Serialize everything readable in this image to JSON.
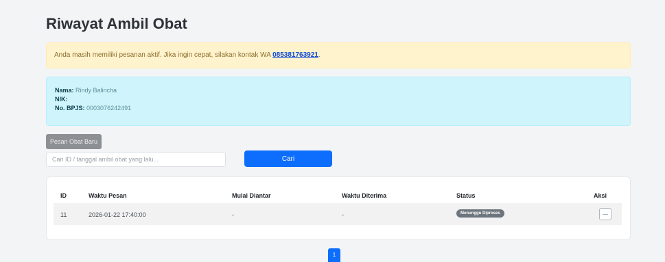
{
  "page": {
    "title": "Riwayat Ambil Obat"
  },
  "notice": {
    "text": "Anda masih memiliki pesanan aktif. Jika ingin cepat, silakan kontak WA ",
    "wa_number": "085381763921",
    "suffix": "."
  },
  "patient": {
    "name_label": "Nama:",
    "name_value": "Rindy Balincha",
    "nik_label": "NIK:",
    "nik_value": "",
    "bpjs_label": "No. BPJS:",
    "bpjs_value": "0003076242491"
  },
  "actions": {
    "new_order_label": "Pesan Obat Baru",
    "search_placeholder": "Cari ID / tanggal ambil obat yang lalu...",
    "search_value": "",
    "search_button_label": "Cari"
  },
  "table": {
    "headers": [
      "ID",
      "Waktu Pesan",
      "Mulai Diantar",
      "Waktu Diterima",
      "Status",
      "Aksi"
    ],
    "rows": [
      {
        "id": "11",
        "waktu_pesan": "2026-01-22 17:40:00",
        "mulai_diantar": "-",
        "waktu_diterima": "-",
        "status": "Menunggu Diproses"
      }
    ]
  },
  "pagination": {
    "current": "1"
  },
  "colors": {
    "primary": "#0d6efd",
    "warning_bg": "#fff3cd",
    "info_bg": "#cff4fc",
    "badge_secondary": "#6c757d"
  },
  "icons": {
    "row_action": "minus-icon"
  }
}
